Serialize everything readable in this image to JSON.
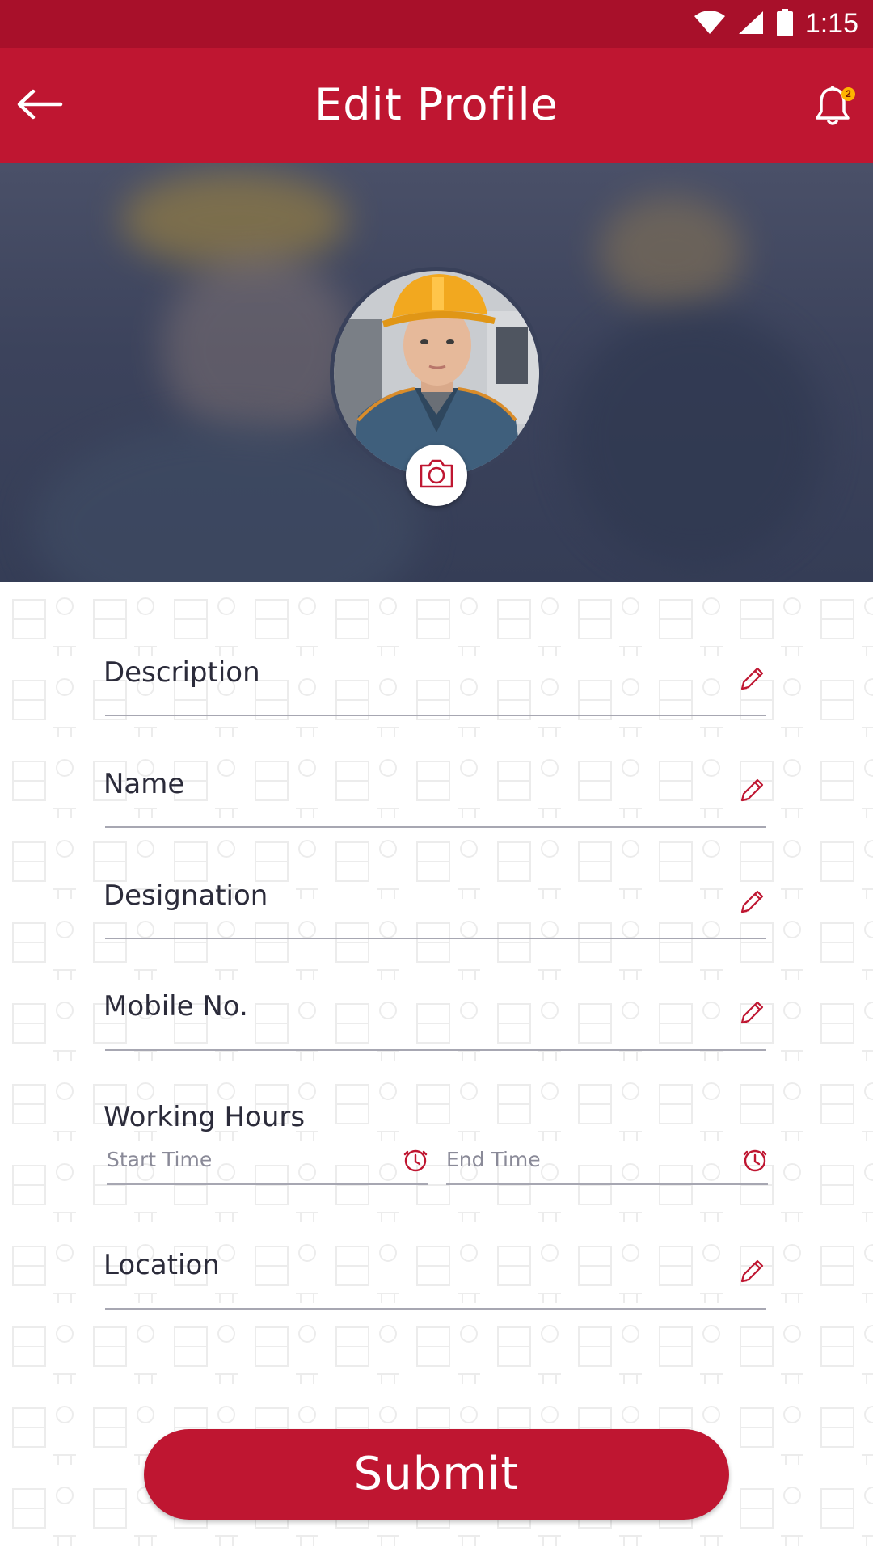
{
  "status_bar": {
    "time": "1:15"
  },
  "app_bar": {
    "title": "Edit Profile",
    "notification_count": "2"
  },
  "profile": {
    "photo_alt": "profile-photo"
  },
  "form": {
    "description_label": "Description",
    "name_label": "Name",
    "designation_label": "Designation",
    "mobile_label": "Mobile No.",
    "working_hours_label": "Working Hours",
    "start_time_placeholder": "Start Time",
    "end_time_placeholder": "End Time",
    "location_label": "Location",
    "submit_label": "Submit"
  },
  "colors": {
    "primary": "#bf1631",
    "status_bar": "#a8102a",
    "badge": "#ffb300"
  }
}
